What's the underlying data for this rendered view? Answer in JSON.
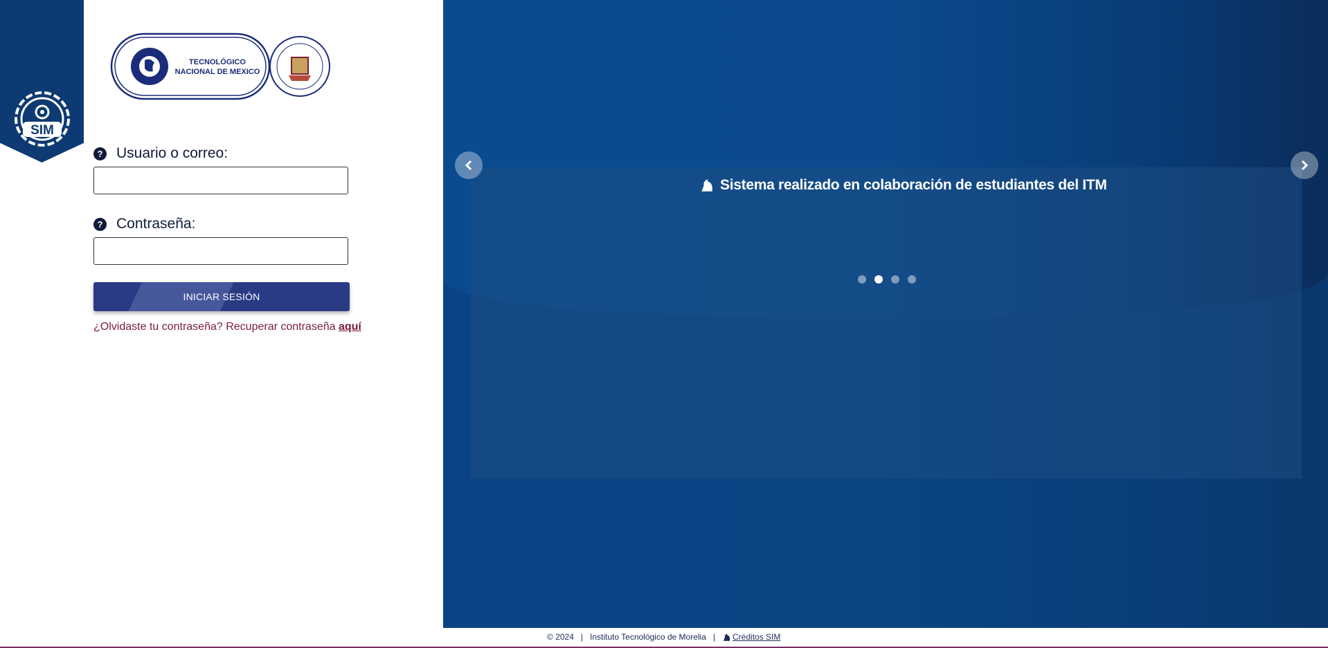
{
  "brand": {
    "sim_logo_text": "SIM",
    "tecnm_logo_text": [
      "TECNOLÓGICO",
      "NACIONAL DE MEXICO"
    ],
    "itm_seal_text": "INSTITUTO TECNOLÓGICO DE MORELIA \"José María Morelos y Pavón\""
  },
  "form": {
    "user_label": "Usuario o correo:",
    "user_value": "",
    "password_label": "Contraseña:",
    "password_value": "",
    "help_glyph": "?",
    "submit_label": "INICIAR SESIÓN",
    "forgot_text": "¿Olvidaste tu contraseña? Recuperar contraseña ",
    "forgot_link": "aquí"
  },
  "carousel": {
    "caption": "Sistema realizado en colaboración de estudiantes del ITM",
    "slide_count": 4,
    "active_index": 1,
    "prev_icon": "chevron-left-icon",
    "next_icon": "chevron-right-icon"
  },
  "footer": {
    "copyright": "© 2024",
    "sep1": "|",
    "institution": "Instituto Tecnológico de Morelia",
    "sep2": "|",
    "credits_link": " Créditos SIM"
  },
  "colors": {
    "navy": "#0d3a73",
    "button": "#2a3b86",
    "link": "#7a1b3a",
    "hero_blue": "#0a4b90"
  }
}
